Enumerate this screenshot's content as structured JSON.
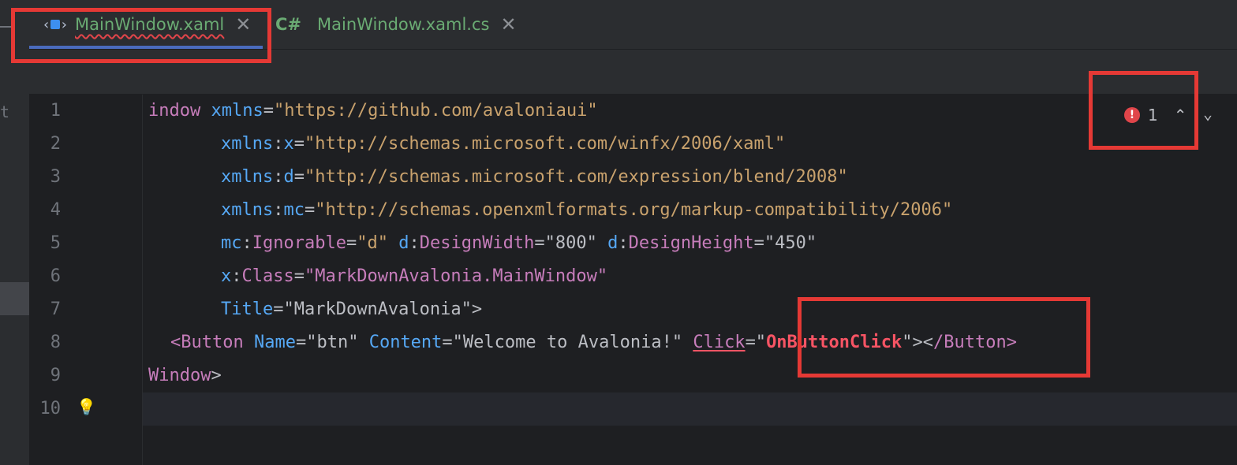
{
  "tabs": [
    {
      "label": "MainWindow.xaml",
      "close": "✕",
      "active": true
    },
    {
      "icon_text": "C#",
      "label": "MainWindow.xaml.cs",
      "close": "✕",
      "active": false
    }
  ],
  "left_strip_char": "t",
  "inspection": {
    "error_count": "1",
    "error_icon": "!",
    "up": "⌃",
    "down": "⌄"
  },
  "code": {
    "line_numbers": [
      "1",
      "2",
      "3",
      "4",
      "5",
      "6",
      "7",
      "8",
      "9",
      "10"
    ],
    "l1": {
      "a": "indow",
      "b": "xmlns",
      "c": "=",
      "d": "\"https://github.com/avaloniaui\""
    },
    "l2": {
      "ns": "xmlns",
      "sep": ":",
      "attr": "x",
      "eq": "=",
      "val": "\"http://schemas.microsoft.com/winfx/2006/xaml\""
    },
    "l3": {
      "ns": "xmlns",
      "sep": ":",
      "attr": "d",
      "eq": "=",
      "val": "\"http://schemas.microsoft.com/expression/blend/2008\""
    },
    "l4": {
      "ns": "xmlns",
      "sep": ":",
      "attr": "mc",
      "eq": "=",
      "val": "\"http://schemas.openxmlformats.org/markup-compatibility/2006\""
    },
    "l5": {
      "ns1": "mc",
      "attr1": "Ignorable",
      "val1": "\"d\"",
      "ns2": "d",
      "attr2": "DesignWidth",
      "val2": "\"800\"",
      "ns3": "d",
      "attr3": "DesignHeight",
      "val3": "\"450\""
    },
    "l6": {
      "ns": "x",
      "attr": "Class",
      "val": "\"MarkDownAvalonia.MainWindow\""
    },
    "l7": {
      "attr": "Title",
      "val": "\"MarkDownAvalonia\"",
      "end": ">"
    },
    "l8": {
      "open": "<",
      "tag": "Button",
      "a1": "Name",
      "v1": "\"btn\"",
      "a2": "Content",
      "v2": "\"Welcome to Avalonia!\"",
      "a3": "Click",
      "q1": "=\"",
      "v3": "OnButtonClick",
      "q2": "\"",
      "close1": "><",
      "close2": "/",
      "tag2": "Button",
      "close3": ">"
    },
    "l9": {
      "tag": "Window",
      "end": ">"
    }
  }
}
